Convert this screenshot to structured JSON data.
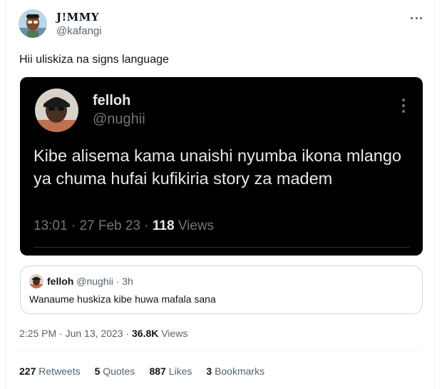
{
  "author": {
    "display_name": "J!MMY",
    "handle": "@kafangi",
    "avatar_icon": "cartoon-avatar-icon"
  },
  "tweet": {
    "text": "Hii uliskiza na signs language"
  },
  "screenshot": {
    "name": "felloh",
    "handle": "@nughii",
    "text": "Kibe alisema kama unaishi nyumba ikona mlango ya chuma hufai kufikiria story za madem",
    "time": "13:01",
    "sep1": "·",
    "date": "27 Feb 23",
    "sep2": "·",
    "views_count": "118",
    "views_label": "Views"
  },
  "quote": {
    "name": "felloh",
    "handle": "@nughii",
    "sep": "·",
    "age": "3h",
    "text": "Wanaume huskiza kibe huwa mafala sana"
  },
  "meta": {
    "time": "2:25 PM",
    "sep1": "·",
    "date": "Jun 13, 2023",
    "sep2": "·",
    "views_count": "36.8K",
    "views_label": "Views"
  },
  "stats": {
    "retweets_count": "227",
    "retweets_label": "Retweets",
    "quotes_count": "5",
    "quotes_label": "Quotes",
    "likes_count": "887",
    "likes_label": "Likes",
    "bookmarks_count": "3",
    "bookmarks_label": "Bookmarks"
  },
  "colors": {
    "text_primary": "#0f1419",
    "text_secondary": "#536471",
    "card_background": "#000000",
    "border": "#cfd9de"
  }
}
